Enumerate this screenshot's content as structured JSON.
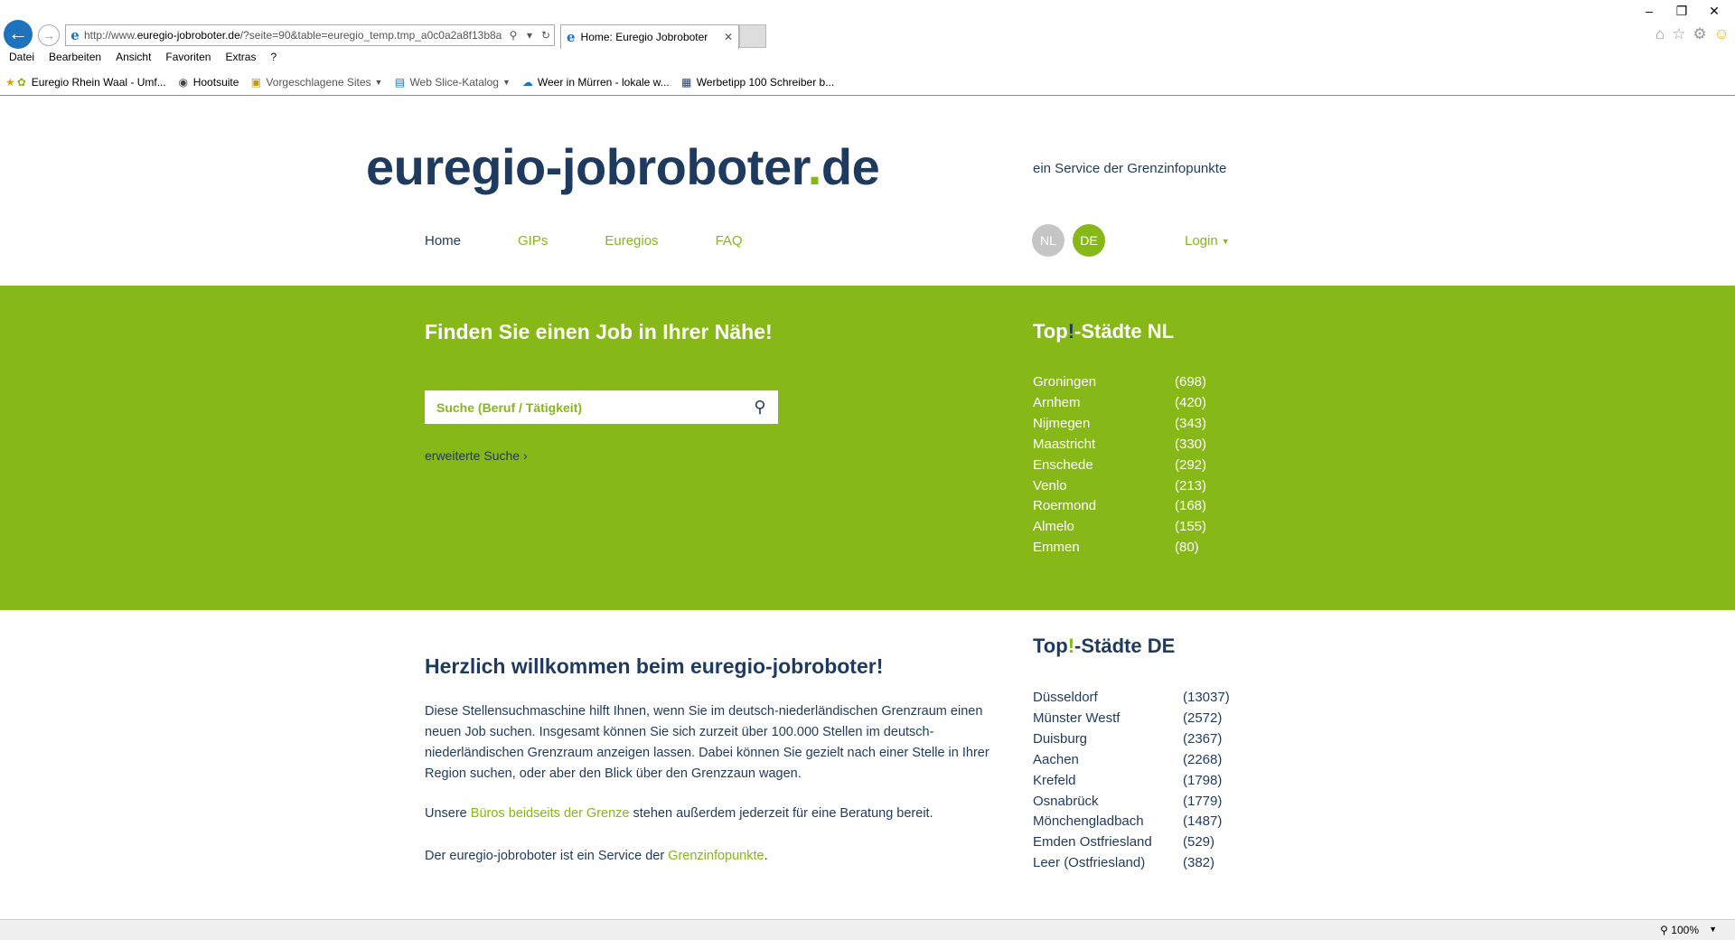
{
  "browser": {
    "url_prefix": "http://www.",
    "url_domain": "euregio-jobroboter.de",
    "url_rest": "/?seite=90&table=euregio_temp.tmp_a0c0a2a8f13b8a",
    "tab_title": "Home: Euregio Jobroboter",
    "menu": [
      "Datei",
      "Bearbeiten",
      "Ansicht",
      "Favoriten",
      "Extras",
      "?"
    ],
    "favorites": [
      {
        "label": "Euregio Rhein Waal - Umf..."
      },
      {
        "label": "Hootsuite"
      },
      {
        "label": "Vorgeschlagene Sites"
      },
      {
        "label": "Web Slice-Katalog"
      },
      {
        "label": "Weer in Mürren - lokale w..."
      },
      {
        "label": "Werbetipp 100 Schreiber b..."
      }
    ],
    "zoom": "100%"
  },
  "site": {
    "logo_main": "euregio-jobroboter",
    "logo_dot": ".",
    "logo_tld": "de",
    "tagline": "ein Service der Grenzinfopunkte",
    "nav": [
      "Home",
      "GIPs",
      "Euregios",
      "FAQ"
    ],
    "lang_nl": "NL",
    "lang_de": "DE",
    "login": "Login"
  },
  "hero": {
    "title": "Finden Sie einen Job in Ihrer Nähe!",
    "search_placeholder": "Suche (Beruf / Tätigkeit)",
    "advanced_link": "erweiterte Suche ›",
    "top_nl_pre": "Top",
    "top_nl_excl": "!",
    "top_nl_post": "-Städte NL",
    "cities_nl": [
      {
        "name": "Groningen",
        "count": "(698)"
      },
      {
        "name": "Arnhem",
        "count": "(420)"
      },
      {
        "name": "Nijmegen",
        "count": "(343)"
      },
      {
        "name": "Maastricht",
        "count": "(330)"
      },
      {
        "name": "Enschede",
        "count": "(292)"
      },
      {
        "name": "Venlo",
        "count": "(213)"
      },
      {
        "name": "Roermond",
        "count": "(168)"
      },
      {
        "name": "Almelo",
        "count": "(155)"
      },
      {
        "name": "Emmen",
        "count": "(80)"
      }
    ]
  },
  "content": {
    "welcome": "Herzlich willkommen beim euregio-jobroboter!",
    "intro": "Diese Stellensuchmaschine hilft Ihnen, wenn Sie im deutsch-niederländischen Grenzraum einen neuen Job suchen. Insgesamt können Sie sich zurzeit über 100.000 Stellen im deutsch-niederländischen Grenzraum anzeigen lassen. Dabei können Sie gezielt nach einer Stelle in Ihrer Region suchen, oder aber den Blick über den Grenzzaun wagen.",
    "p2_pre": "Unsere ",
    "p2_link": "Büros beidseits der Grenze",
    "p2_post": " stehen außerdem jederzeit für eine Beratung bereit.",
    "p3_pre": "Der euregio-jobroboter ist ein Service der ",
    "p3_link": "Grenzinfopunkte",
    "p3_post": ".",
    "top_de_pre": "Top",
    "top_de_excl": "!",
    "top_de_post": "-Städte DE",
    "cities_de": [
      {
        "name": "Düsseldorf",
        "count": "(13037)"
      },
      {
        "name": "Münster Westf",
        "count": "(2572)"
      },
      {
        "name": "Duisburg",
        "count": "(2367)"
      },
      {
        "name": "Aachen",
        "count": "(2268)"
      },
      {
        "name": "Krefeld",
        "count": "(1798)"
      },
      {
        "name": "Osnabrück",
        "count": "(1779)"
      },
      {
        "name": "Mönchengladbach",
        "count": "(1487)"
      },
      {
        "name": "Emden Ostfriesland",
        "count": "(529)"
      },
      {
        "name": "Leer (Ostfriesland)",
        "count": "(382)"
      }
    ]
  }
}
